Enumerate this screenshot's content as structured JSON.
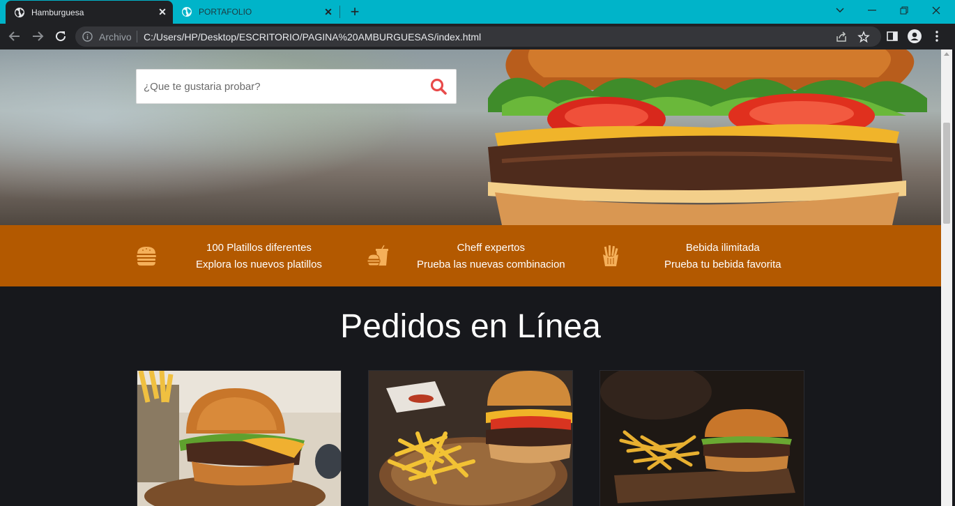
{
  "browser": {
    "tabs": [
      {
        "title": "Hamburguesa",
        "active": true
      },
      {
        "title": "PORTAFOLIO",
        "active": false
      }
    ],
    "omnibox": {
      "security_chip": "Archivo",
      "url": "C:/Users/HP/Desktop/ESCRITORIO/PAGINA%20AMBURGUESAS/index.html"
    }
  },
  "page": {
    "search": {
      "placeholder": "¿Que te gustaria probar?"
    },
    "features": [
      {
        "icon": "burger-icon",
        "title": "100 Platillos diferentes",
        "subtitle": "Explora los nuevos platillos"
      },
      {
        "icon": "combo-meal-icon",
        "title": "Cheff expertos",
        "subtitle": "Prueba las nuevas combinacion"
      },
      {
        "icon": "fries-icon",
        "title": "Bebida ilimitada",
        "subtitle": "Prueba tu bebida favorita"
      }
    ],
    "section_title": "Pedidos en Línea"
  },
  "colors": {
    "tabbar": "#00b4c9",
    "feature_band": "#b35900",
    "feature_icon": "#f5b05a",
    "search_icon": "#e84a4a",
    "page_bg": "#17181c"
  }
}
